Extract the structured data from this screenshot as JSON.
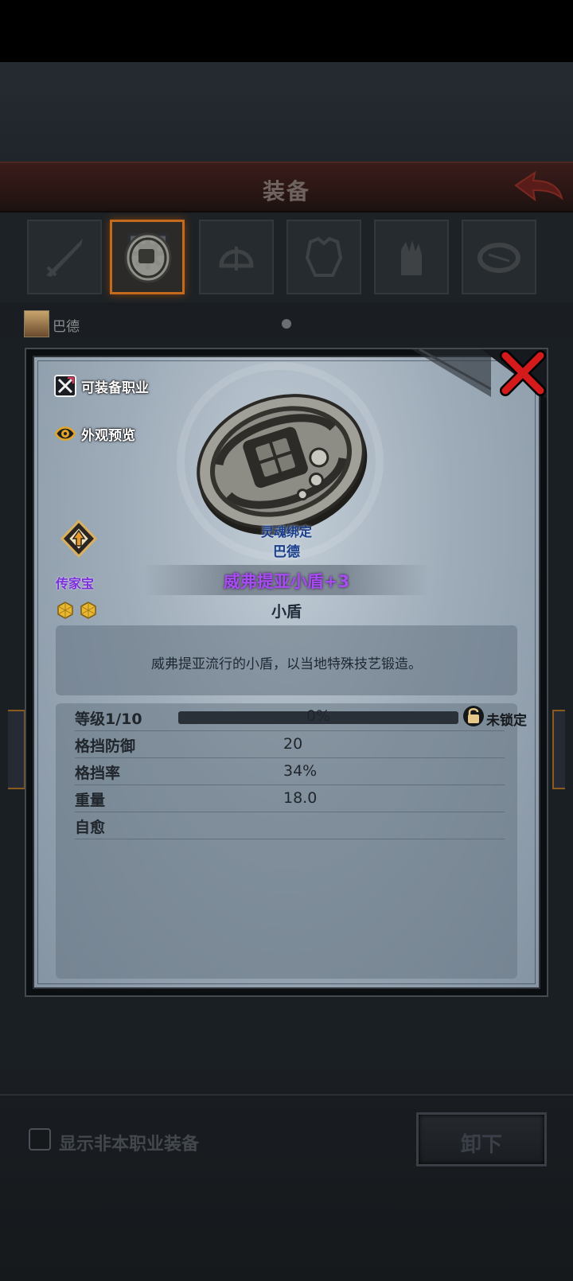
{
  "header": {
    "title": "装备"
  },
  "character": {
    "name": "巴德"
  },
  "bottom": {
    "checkbox_label": "显示非本职业装备",
    "unequip_label": "卸下"
  },
  "modal": {
    "equippable_class_label": "可装备职业",
    "appearance_preview_label": "外观预览",
    "soulbound_label": "灵魂绑定",
    "soulbound_name": "巴德",
    "heirloom_label": "传家宝",
    "item_name": "威弗提亚小盾+3",
    "item_type": "小盾",
    "description": "威弗提亚流行的小盾，以当地特殊技艺锻造。",
    "stats": {
      "level_label": "等级1/10",
      "level_progress": "0%",
      "level_fraction": 0,
      "lock_label": "未锁定",
      "rows": [
        {
          "label": "格挡防御",
          "value": "20"
        },
        {
          "label": "格挡率",
          "value": "34%"
        },
        {
          "label": "重量",
          "value": "18.0"
        },
        {
          "label": "自愈",
          "value": ""
        }
      ]
    }
  },
  "colors": {
    "item_name": "#a64cf0",
    "heirloom": "#7b2fd8",
    "soulbound": "#1a3e8a",
    "close_x": "#d41a1a"
  }
}
